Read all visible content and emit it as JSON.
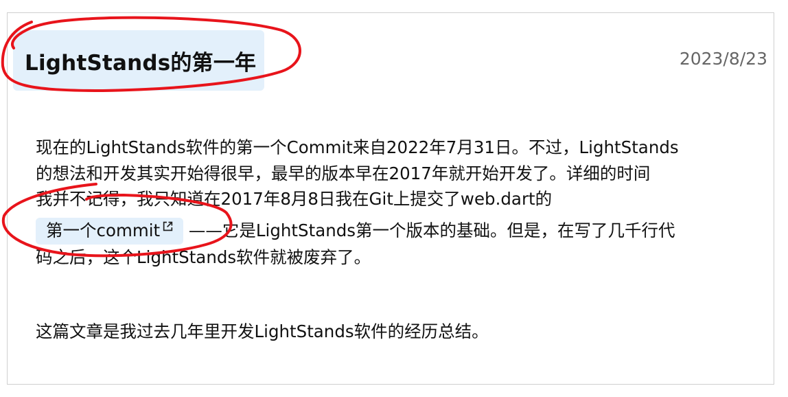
{
  "post": {
    "title": "LightStands的第一年",
    "date": "2023/8/23",
    "paragraph1": {
      "line1": "现在的LightStands软件的第一个Commit来自2022年7月31日。不过，LightStands",
      "line2": "的想法和开发其实开始得很早，最早的版本早在2017年就开始开发了。详细的时间",
      "line3": "我并不记得，我只知道在2017年8月8日我在Git上提交了web.dart的",
      "link_label": "第一个commit",
      "line4_rest": " ——它是LightStands第一个版本的基础。但是，在写了几千行代",
      "line5": "码之后，这个LightStands软件就被废弃了。"
    },
    "paragraph2": "这篇文章是我过去几年里开发LightStands软件的经历总结。"
  },
  "icons": {
    "link_icon": "external-link-icon"
  },
  "colors": {
    "chip_background": "#e3f0fb",
    "annotation_red": "#e8141b",
    "date_text": "#666666",
    "card_border": "#cfcfcf"
  }
}
